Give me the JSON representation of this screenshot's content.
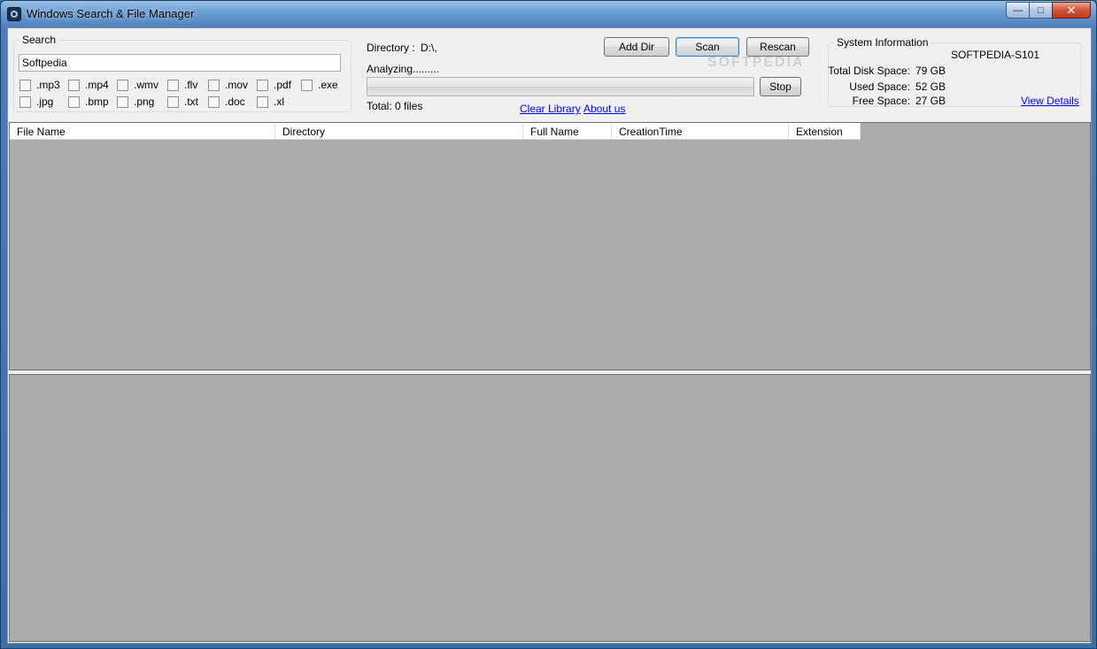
{
  "window": {
    "title": "Windows Search & File Manager",
    "controls": {
      "minimize": "—",
      "maximize": "□",
      "close": "✕"
    }
  },
  "search": {
    "group_label": "Search",
    "query": "Softpedia",
    "filters": [
      ".mp3",
      ".mp4",
      ".wmv",
      ".flv",
      ".mov",
      ".pdf",
      ".exe",
      ".jpg",
      ".bmp",
      ".png",
      ".txt",
      ".doc",
      ".xl"
    ]
  },
  "scan": {
    "directory_label": "Directory :",
    "directory_value": "D:\\,",
    "status": "Analyzing.........",
    "total": "Total: 0 files",
    "progress": 0,
    "buttons": {
      "add_dir": "Add Dir",
      "scan": "Scan",
      "rescan": "Rescan",
      "stop": "Stop"
    },
    "links": {
      "clear_library": "Clear Library",
      "about_us": "About us"
    }
  },
  "system_info": {
    "group_label": "System Information",
    "machine": "SOFTPEDIA-S101",
    "total_label": "Total Disk Space:",
    "total_value": "79 GB",
    "used_label": "Used Space:",
    "used_value": "52 GB",
    "free_label": "Free Space:",
    "free_value": "27 GB",
    "details_link": "View Details"
  },
  "results": {
    "columns": [
      "File Name",
      "Directory",
      "Full Name",
      "CreationTime",
      "Extension"
    ]
  },
  "watermark": "SOFTPEDIA",
  "colors": {
    "link": "#0000ff",
    "grid_bg": "#ababab",
    "title_bar": "#6d9fd4"
  }
}
